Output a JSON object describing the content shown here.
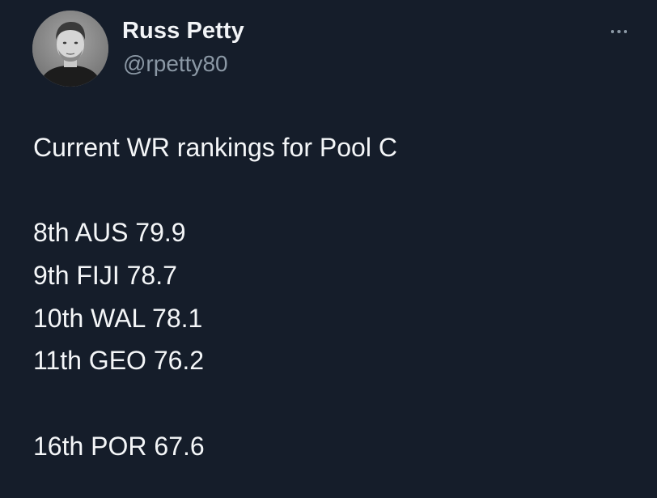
{
  "author": {
    "name": "Russ Petty",
    "handle": "@rpetty80",
    "avatar_icon": "profile-photo"
  },
  "more_icon": "more-horizontal-icon",
  "tweet": {
    "headline": "Current WR rankings for Pool C",
    "rankings": [
      "8th AUS 79.9",
      "9th FIJI 78.7",
      "10th WAL 78.1",
      "11th GEO 76.2"
    ],
    "footer_ranking": "16th POR 67.6"
  },
  "colors": {
    "background": "#151d2a",
    "text_primary": "#f4f6f8",
    "text_secondary": "#8b98a5"
  }
}
